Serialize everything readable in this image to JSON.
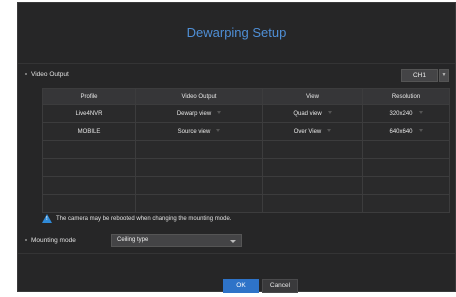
{
  "dialog": {
    "title": "Dewarping Setup"
  },
  "video_output": {
    "label": "Video Output",
    "channel": "CH1"
  },
  "table": {
    "headers": [
      "Profile",
      "Video Output",
      "View",
      "Resolution"
    ],
    "rows": [
      [
        "Live4NVR",
        "Dewarp view",
        "Quad view",
        "320x240"
      ],
      [
        "MOBILE",
        "Source view",
        "Over View",
        "640x640"
      ],
      [
        "",
        "",
        "",
        ""
      ],
      [
        "",
        "",
        "",
        ""
      ],
      [
        "",
        "",
        "",
        ""
      ],
      [
        "",
        "",
        "",
        ""
      ]
    ]
  },
  "warning": {
    "text": "The camera may be rebooted when changing the mounting mode."
  },
  "mounting": {
    "label": "Mounting mode",
    "value": "Ceiling type"
  },
  "buttons": {
    "ok": "OK",
    "cancel": "Cancel"
  },
  "colors": {
    "accent": "#2e73c8",
    "title": "#4f8fd6",
    "background": "#262627"
  }
}
